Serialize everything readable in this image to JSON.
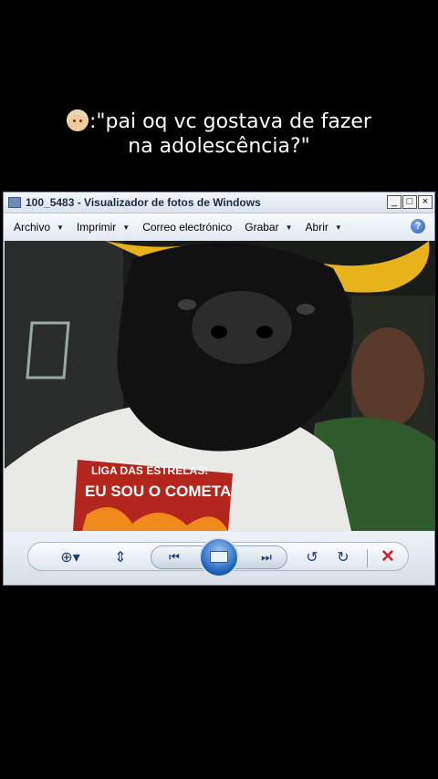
{
  "caption": {
    "line1": ":\"pai oq vc gostava de fazer",
    "line2": "na adolescência?\"",
    "emoji": "older-person-emoji"
  },
  "window": {
    "title": "100_5483 - Visualizador de fotos de Windows",
    "controls": {
      "minimize": "_",
      "maximize": "□",
      "close": "×"
    }
  },
  "menubar": {
    "items": [
      {
        "label": "Archivo"
      },
      {
        "label": "Imprimir"
      },
      {
        "label": "Correo electrónico"
      },
      {
        "label": "Grabar"
      },
      {
        "label": "Abrir"
      }
    ],
    "help": "?"
  },
  "photo": {
    "shirt_text_line1": "LIGA DAS ESTRELAS!",
    "shirt_text_line2": "EU SOU O COMETA"
  },
  "toolbar": {
    "zoom": "zoom-icon",
    "fit": "actual-size-icon",
    "previous": "previous-icon",
    "slideshow": "slideshow-icon",
    "next": "next-icon",
    "rotate_left": "rotate-counterclockwise-icon",
    "rotate_right": "rotate-clockwise-icon",
    "delete": "delete-icon"
  },
  "colors": {
    "accent": "#1d5fb8",
    "delete": "#c0282b",
    "horn": "#e8b21a"
  }
}
